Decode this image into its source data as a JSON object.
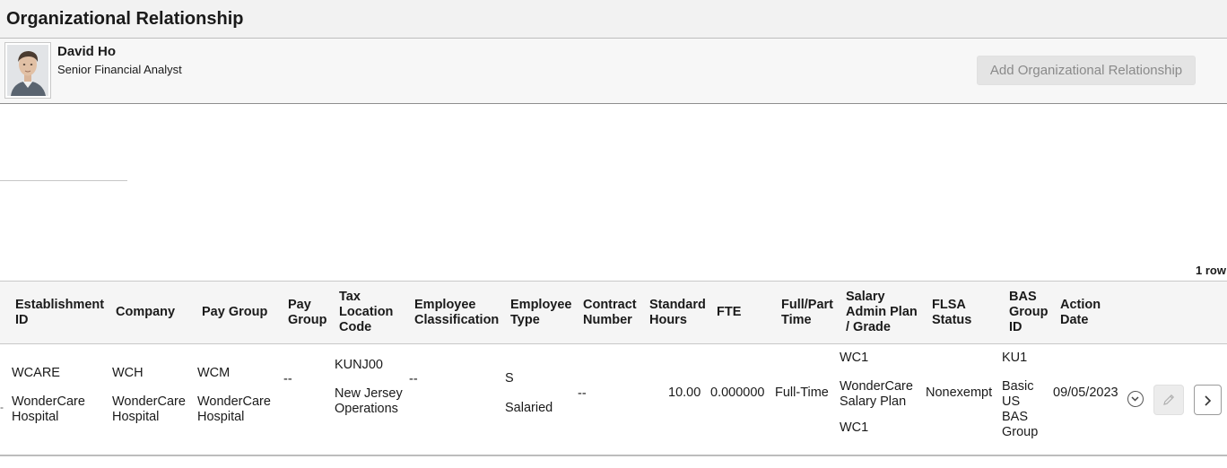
{
  "page": {
    "title": "Organizational Relationship"
  },
  "person": {
    "name": "David Ho",
    "job_title": "Senior Financial Analyst"
  },
  "actions": {
    "add_label": "Add Organizational Relationship"
  },
  "grid": {
    "row_count": "1 row",
    "columns": {
      "establishment_id": "Establishment ID",
      "company": "Company",
      "pay_group": "Pay Group",
      "pay_group2": "Pay Group",
      "tax_location_code": "Tax Location Code",
      "employee_classification": "Employee Classification",
      "employee_type": "Employee Type",
      "contract_number": "Contract Number",
      "standard_hours": "Standard Hours",
      "fte": "FTE",
      "full_part_time": "Full/Part Time",
      "salary_plan_grade": "Salary Admin Plan / Grade",
      "flsa_status": "FLSA Status",
      "bas_group_id": "BAS Group ID",
      "action_date": "Action Date"
    },
    "row": {
      "establishment_code": "WCARE",
      "establishment_name": "WonderCare Hospital",
      "company_code": "WCH",
      "company_name": "WonderCare Hospital",
      "pay_group_code": "WCM",
      "pay_group_name": "WonderCare Hospital",
      "pay_group2": "--",
      "tax_location_code": "KUNJ00",
      "tax_location_name": "New Jersey Operations",
      "employee_classification": "--",
      "employee_type_code": "S",
      "employee_type_name": "Salaried",
      "contract_number": "--",
      "standard_hours": "10.00",
      "fte": "0.000000",
      "full_part_time": "Full-Time",
      "salary_plan": "WC1",
      "salary_plan_name": "WonderCare Salary Plan",
      "salary_grade": "WC1",
      "flsa_status": "Nonexempt",
      "bas_group_code": "KU1",
      "bas_group_name": "Basic US BAS Group",
      "action_date": "09/05/2023",
      "left_marker": "-"
    }
  },
  "icons": {
    "avatar": "person-photo",
    "expand": "chevron-down-circle-icon",
    "edit": "pencil-icon",
    "next": "chevron-right-icon"
  }
}
